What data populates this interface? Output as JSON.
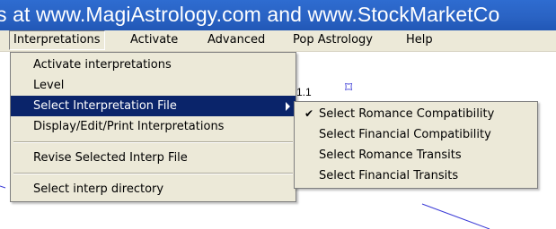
{
  "window": {
    "title": "s at www.MagiAstrology.com and www.StockMarketCo"
  },
  "menubar": {
    "items": [
      {
        "label": "Interpretations"
      },
      {
        "label": "Activate"
      },
      {
        "label": "Advanced"
      },
      {
        "label": "Pop Astrology"
      },
      {
        "label": "Help"
      }
    ]
  },
  "chart": {
    "label": "1.1",
    "glyph": "⌑"
  },
  "interpretations_menu": {
    "items": [
      {
        "label": "Activate interpretations"
      },
      {
        "label": "Level"
      },
      {
        "label": "Select Interpretation File",
        "submenu": true,
        "highlighted": true
      },
      {
        "label": "Display/Edit/Print Interpretations"
      },
      {
        "label": "Revise Selected Interp File"
      },
      {
        "label": "Select interp directory"
      }
    ]
  },
  "submenu": {
    "items": [
      {
        "label": "Select Romance Compatibility",
        "checked": true
      },
      {
        "label": "Select Financial Compatibility",
        "checked": false
      },
      {
        "label": "Select Romance Transits",
        "checked": false
      },
      {
        "label": "Select Financial Transits",
        "checked": false
      }
    ]
  },
  "colors": {
    "titlebar": "#2a63c4",
    "menubar": "#ece9d8",
    "highlight": "#0a246a"
  }
}
